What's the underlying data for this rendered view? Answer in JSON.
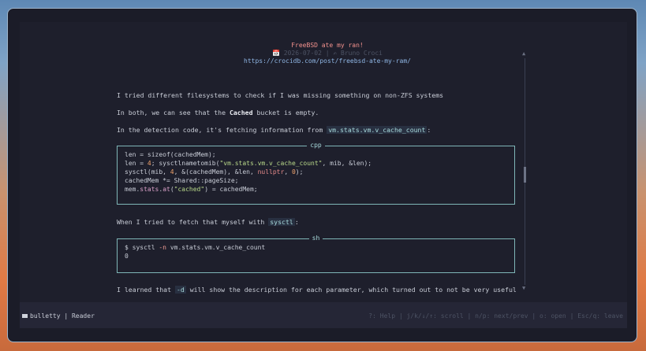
{
  "article": {
    "title": "FreeBSD ate my ran!",
    "meta": "📅 2026-07-02 | ✍ Bruno Croci",
    "url": "https://crocidb.com/post/freebsd-ate-my-ram/",
    "para1": "I tried different filesystems to check if I was missing something on non-ZFS systems",
    "para2_pre": "In both, we can see that the ",
    "para2_bold": "Cached",
    "para2_post": " bucket is empty.",
    "para3_pre": "In the detection code, it's fetching information from ",
    "para3_code": "vm.stats.vm.v_cache_count",
    "para3_post": ":",
    "para4_pre": "When I tried to fetch that myself with ",
    "para4_code": "sysctl",
    "para4_post": ":",
    "para5_pre": "I learned that ",
    "para5_code": "-d",
    "para5_post": " will show the description for each parameter, which turned out to not be very useful"
  },
  "code_block_1": {
    "lang": "cpp",
    "lines": {
      "l1": "len = sizeof(cachedMem);",
      "l2_a": "len = ",
      "l2_num": "4",
      "l2_b": "; sysctlnametomib(",
      "l2_str": "\"vm.stats.vm.v_cache_count\"",
      "l2_c": ", mib, &len);",
      "l3_a": "sysctl(mib, ",
      "l3_num1": "4",
      "l3_b": ", &(cachedMem), &len, ",
      "l3_kw": "nullptr",
      "l3_c": ", ",
      "l3_num2": "0",
      "l3_d": ");",
      "l4": "cachedMem *= Shared::pageSize;",
      "l5_a": "mem.",
      "l5_fn": "stats",
      "l5_b": ".",
      "l5_fn2": "at",
      "l5_c": "(",
      "l5_str": "\"cached\"",
      "l5_d": ") = cachedMem;"
    }
  },
  "code_block_2": {
    "lang": "sh",
    "line1_a": "$ sysctl ",
    "line1_flag": "-n",
    "line1_b": " vm.stats.vm.v_cache_count",
    "line2": "0"
  },
  "scrollbar": {
    "up": "▲",
    "down": "▼",
    "position": 0.48
  },
  "footer": {
    "app": "bulletty | Reader",
    "help": "?: Help | j/k/↓/↑: scroll | n/p: next/prev | o: open | Esc/q: leave"
  },
  "colors": {
    "title": "#f3928e",
    "url": "#8fb6e4",
    "border": "#7fb6b8",
    "background": "#1e1f2c"
  }
}
